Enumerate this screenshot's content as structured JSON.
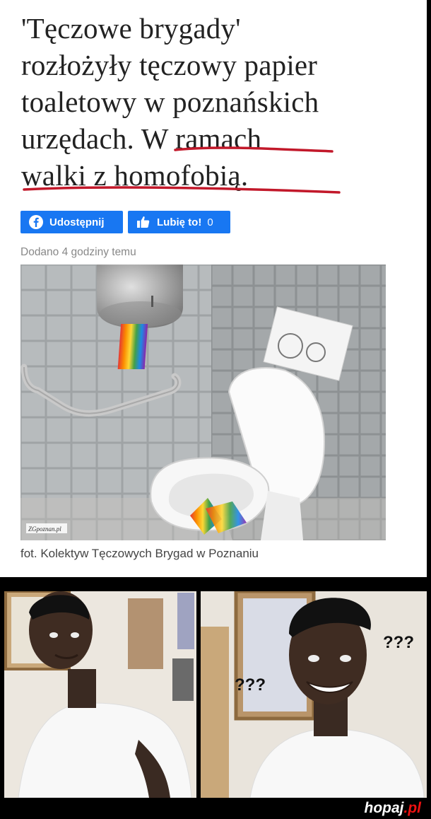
{
  "headline": {
    "line1": "'Tęczowe brygady'",
    "line2": "rozłożyły tęczowy papier",
    "line3": "toaletowy w poznańskich",
    "line4": "urzędach. W ramach",
    "line5": "walki z homofobią."
  },
  "buttons": {
    "share_label": "Udostępnij",
    "like_label": "Lubię to!",
    "like_count": "0",
    "share_icon": "facebook-icon",
    "like_icon": "thumbs-up-icon",
    "color": "#1877f2"
  },
  "meta": {
    "added": "Dodano 4 godziny temu"
  },
  "photo": {
    "watermark": "ZGpoznan.pl"
  },
  "caption": "fot. Kolektyw Tęczowych Brygad w Poznaniu",
  "meme": {
    "left_text": "???",
    "right_text": "???"
  },
  "brand": {
    "name": "hopaj",
    "tld": ".pl"
  }
}
